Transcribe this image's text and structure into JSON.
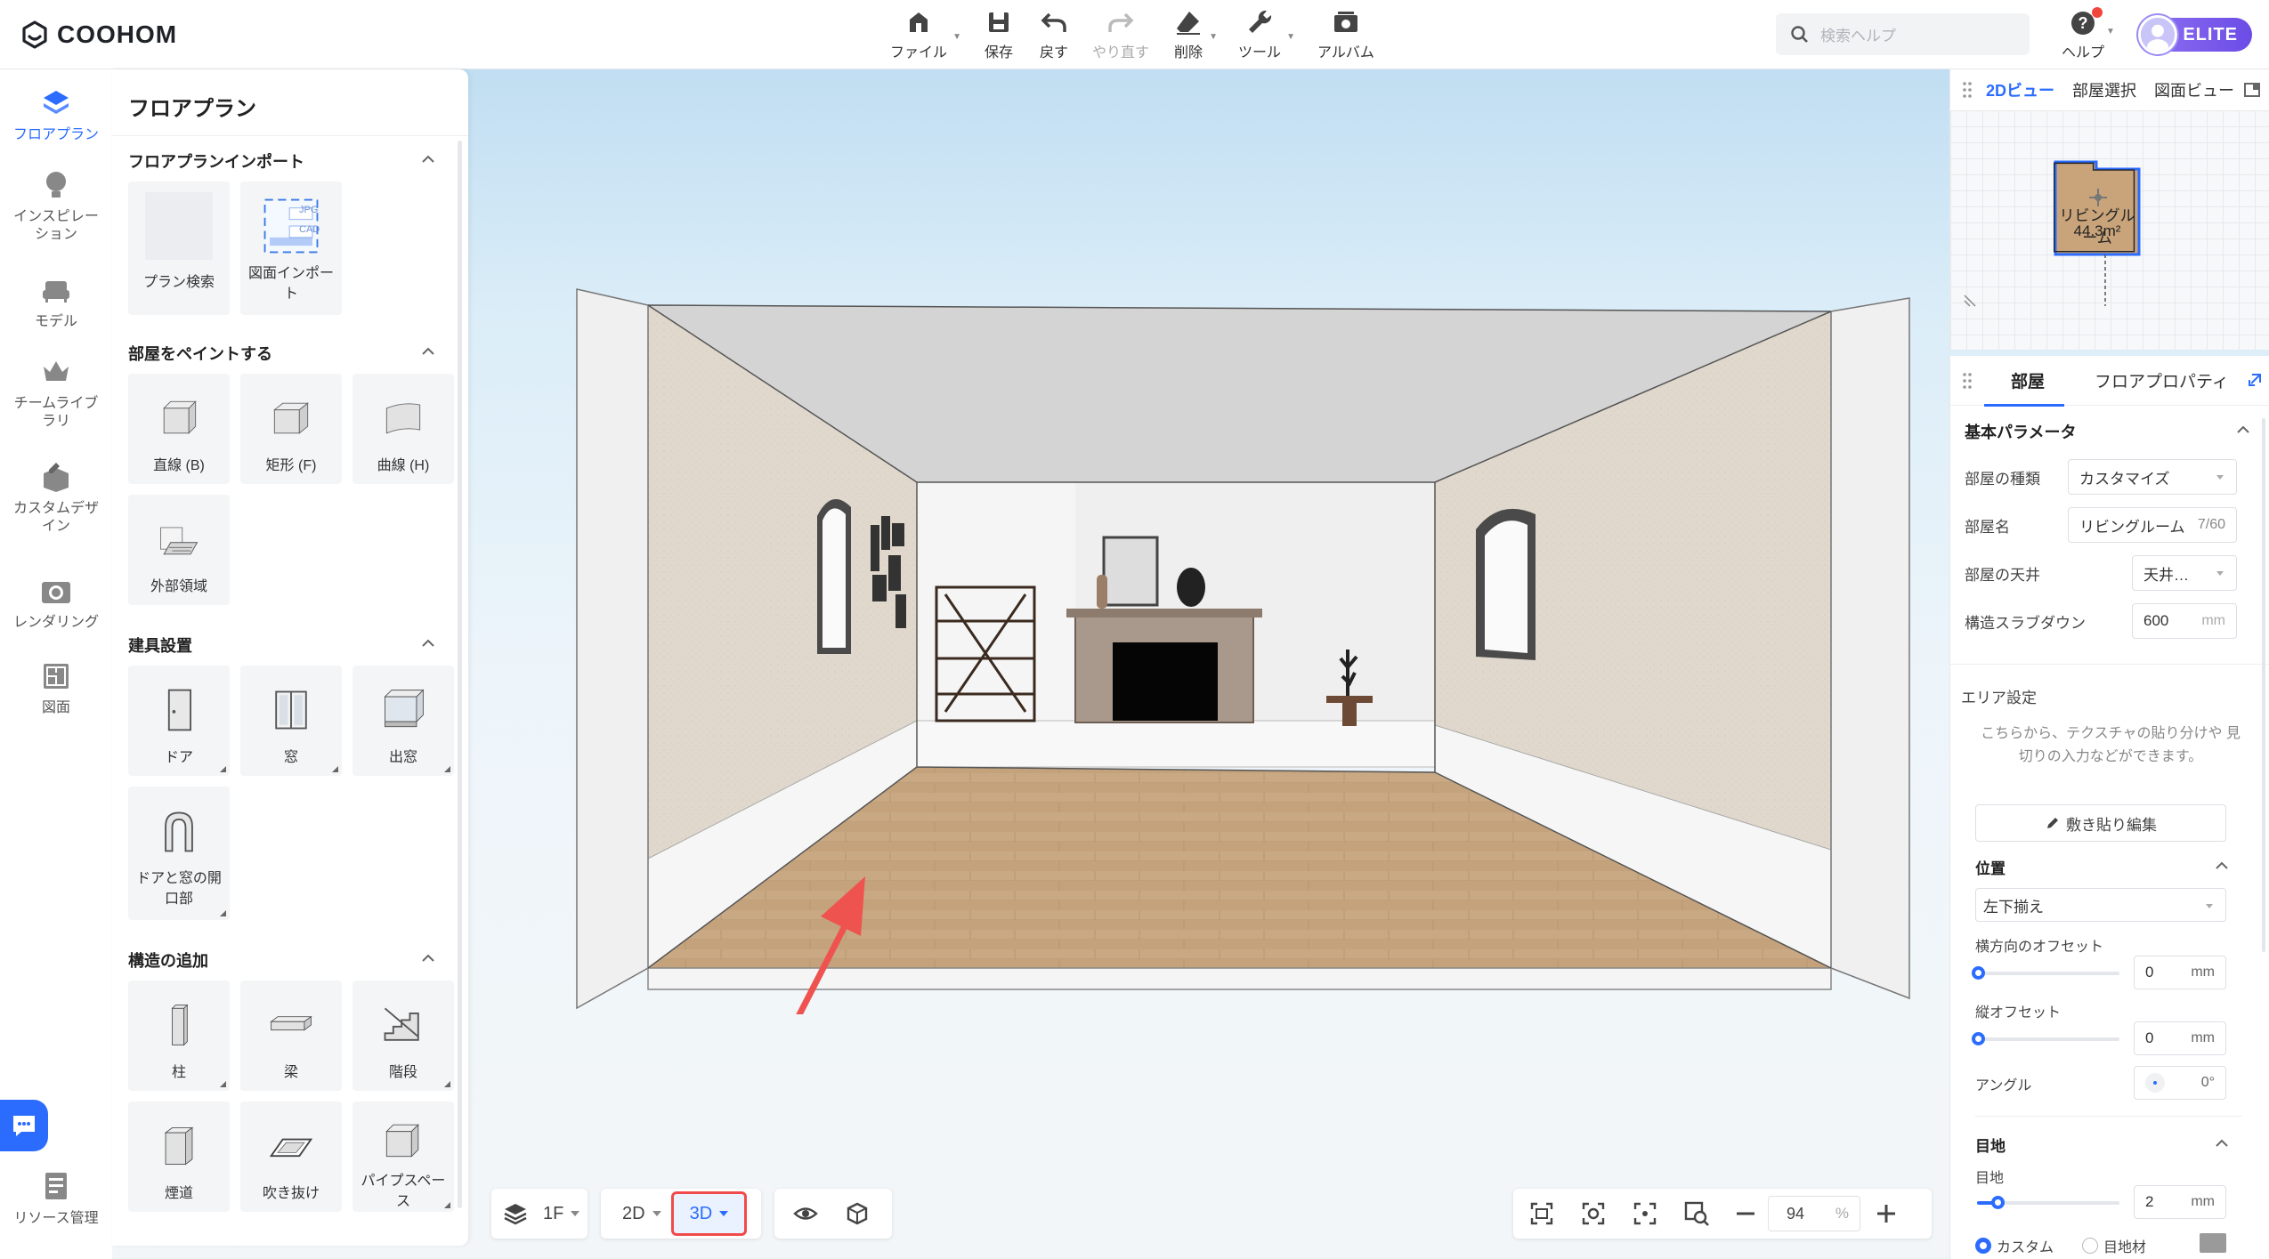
{
  "app": {
    "logo_text": "COOHOM"
  },
  "toolbar": {
    "file": "ファイル",
    "save": "保存",
    "undo": "戻す",
    "redo": "やり直す",
    "delete": "削除",
    "tools": "ツール",
    "album": "アルバム"
  },
  "search": {
    "placeholder": "検索ヘルプ"
  },
  "help": {
    "label": "ヘルプ"
  },
  "account": {
    "badge": "ELITE"
  },
  "rail": {
    "items": [
      {
        "label": "フロアプラン"
      },
      {
        "label": "インスピレーション"
      },
      {
        "label": "モデル"
      },
      {
        "label": "チームライブラリ"
      },
      {
        "label": "カスタムデザイン"
      },
      {
        "label": "レンダリング"
      },
      {
        "label": "図面"
      }
    ],
    "resource": "リソース管理"
  },
  "panel": {
    "title": "フロアプラン",
    "sections": {
      "import": {
        "title": "フロアプランインポート",
        "plan_search": "プラン検索",
        "drawing_import": "図面インポート",
        "tag_jpg": "JPG",
        "tag_cad": "CAD"
      },
      "paint": {
        "title": "部屋をペイントする",
        "line": "直線 (B)",
        "rect": "矩形 (F)",
        "curve": "曲線 (H)",
        "outer": "外部領域"
      },
      "fixtures": {
        "title": "建具設置",
        "door": "ドア",
        "window": "窓",
        "bay": "出窓",
        "opening": "ドアと窓の開口部"
      },
      "structure": {
        "title": "構造の追加",
        "column": "柱",
        "beam": "梁",
        "stairs": "階段",
        "chimney": "煙道",
        "void": "吹き抜け",
        "pipe": "パイプスペース"
      }
    }
  },
  "viewbar": {
    "floor": "1F",
    "mode_2d": "2D",
    "mode_3d": "3D",
    "zoom": "94",
    "zoom_unit": "%"
  },
  "minimap": {
    "tabs": [
      "2Dビュー",
      "部屋選択",
      "図面ビュー"
    ],
    "room_name": "リビングルーム",
    "room_area": "44.3m²"
  },
  "props": {
    "tabs": [
      "部屋",
      "フロアプロパティ"
    ],
    "basic": {
      "title": "基本パラメータ",
      "room_type_label": "部屋の種類",
      "room_type_value": "カスタマイズ",
      "room_name_label": "部屋名",
      "room_name_value": "リビングルーム",
      "room_name_count": "7/60",
      "ceiling_label": "部屋の天井",
      "ceiling_value": "天井…",
      "slab_label": "構造スラブダウン",
      "slab_value": "600",
      "slab_unit": "mm"
    },
    "area": {
      "title": "エリア設定",
      "desc": "こちらから、テクスチャの貼り分けや 見切りの入力などができます。",
      "edit_button": "敷き貼り編集"
    },
    "position": {
      "title": "位置",
      "align_value": "左下揃え",
      "h_offset_label": "横方向のオフセット",
      "h_offset_value": "0",
      "v_offset_label": "縦オフセット",
      "v_offset_value": "0",
      "unit": "mm",
      "angle_label": "アングル",
      "angle_value": "0°"
    },
    "joint": {
      "title": "目地",
      "joint_label": "目地",
      "joint_value": "2",
      "unit": "mm",
      "opt_custom": "カスタム",
      "opt_material": "目地材"
    }
  }
}
